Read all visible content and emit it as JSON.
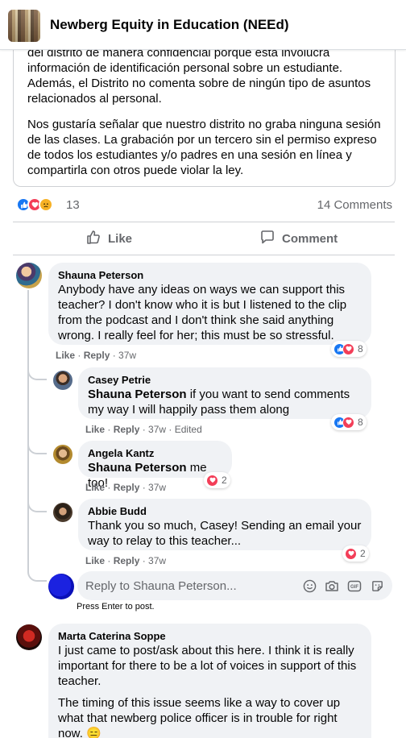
{
  "group": {
    "title": "Newberg Equity in Education (NEEd)"
  },
  "post": {
    "paragraph1": "del distrito de manera confidencial porque ésta involucra información de identificación personal sobre un estudiante. Además, el Distrito no comenta sobre de ningún tipo de asuntos relacionados al personal.",
    "paragraph2": "Nos gustaría señalar que nuestro distrito no graba ninguna sesión de las clases. La grabación por un tercero sin el permiso expreso de todos los estudiantes y/o padres en una sesión en línea y compartirla con otros puede violar la ley.",
    "reaction_count": "13",
    "comments_count": "14 Comments",
    "reaction_icons": [
      "like-icon",
      "love-icon",
      "sad-icon"
    ]
  },
  "actions": {
    "like_label": "Like",
    "comment_label": "Comment"
  },
  "comments": [
    {
      "name": "Shauna Peterson",
      "text": "Anybody have any ideas on ways we can support this teacher? I don't know who it is but I listened to the clip from the podcast and I don't think she said anything wrong. I really feel for her; this must be so stressful.",
      "like": "Like",
      "reply": "Reply",
      "time": "37w",
      "reaction_count": "8"
    },
    {
      "name": "Casey Petrie",
      "tag": "Shauna Peterson",
      "text": " if you want to send comments my way I will happily pass them along",
      "like": "Like",
      "reply": "Reply",
      "time": "37w",
      "edited": "Edited",
      "reaction_count": "8"
    },
    {
      "name": "Angela Kantz",
      "tag": "Shauna Peterson",
      "text": " me too!",
      "like": "Like",
      "reply": "Reply",
      "time": "37w",
      "reaction_count": "2"
    },
    {
      "name": "Abbie Budd",
      "text": "Thank you so much, Casey! Sending an email your way to relay to this teacher...",
      "like": "Like",
      "reply": "Reply",
      "time": "37w",
      "reaction_count": "2"
    },
    {
      "name": "Marta Caterina Soppe",
      "text1": "I just came to post/ask about this here. I think it is really important for there to be a lot of voices in support of this teacher.",
      "text2": "The timing of this issue seems like a way to cover up what that newberg police officer is in trouble for right now. 😑"
    }
  ],
  "reply_box": {
    "placeholder": "Reply to Shauna Peterson...",
    "hint": "Press Enter to post.",
    "icons": [
      "emoji-icon",
      "camera-icon",
      "gif-icon",
      "sticker-icon"
    ]
  },
  "colors": {
    "like_blue": "#1877f2",
    "love_red": "#f33e58",
    "sad_yellow": "#f7b125",
    "bubble_bg": "#f0f2f5",
    "muted": "#65676b"
  }
}
